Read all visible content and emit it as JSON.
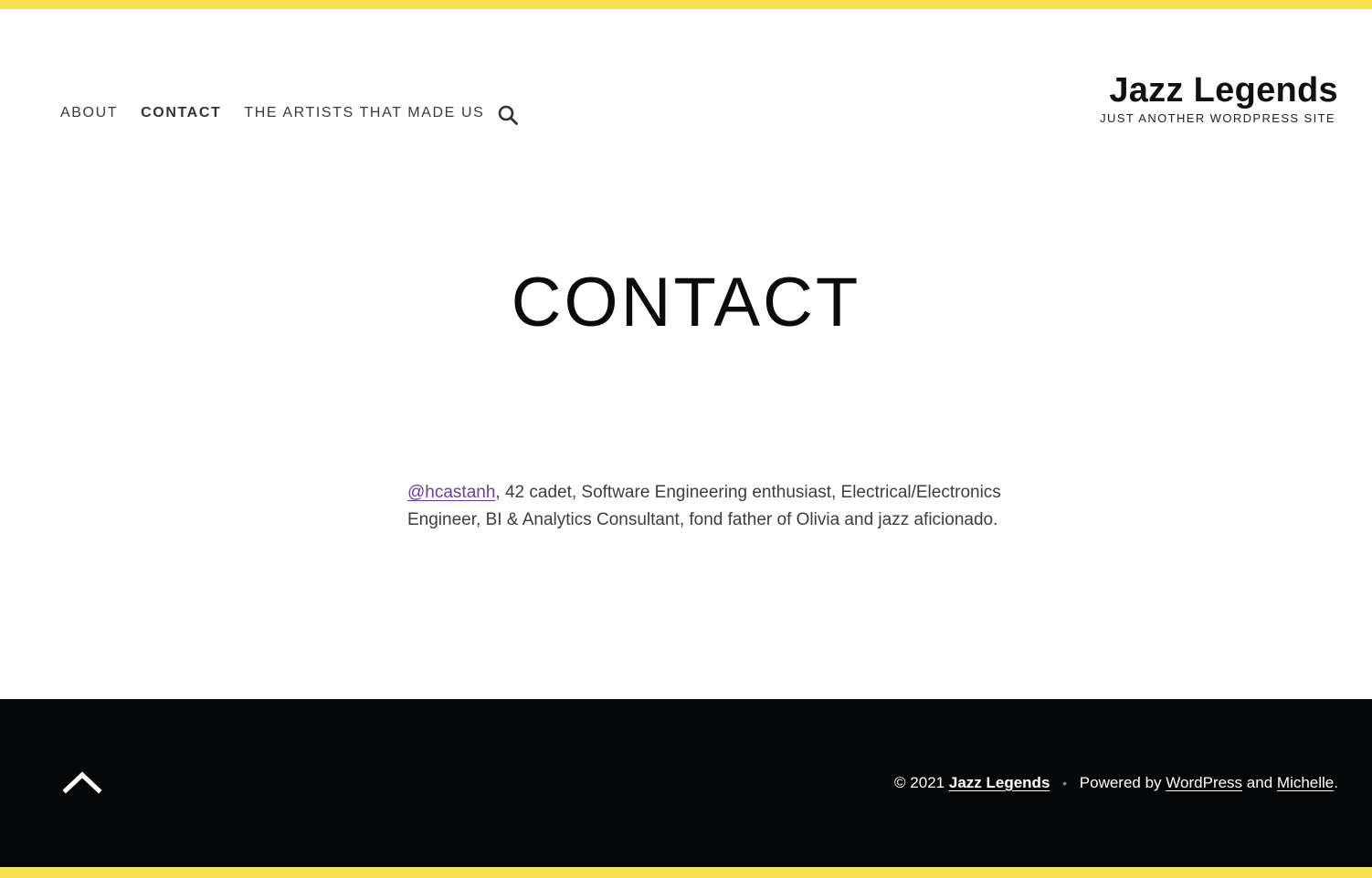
{
  "colors": {
    "accent_bar": "#f9e24f",
    "footer_bg": "#050608",
    "link": "#6a3aa6"
  },
  "header": {
    "nav": [
      {
        "label": "About"
      },
      {
        "label": "Contact"
      },
      {
        "label": "The Artists That Made Us"
      }
    ],
    "current": "Contact",
    "search_icon": "search-icon",
    "site_title": "Jazz Legends",
    "tagline": "Just another WordPress site"
  },
  "main": {
    "title": "CONTACT",
    "handle_link": "@hcastanh",
    "bio_rest": ", 42 cadet, Software Engineering enthusiast, Electrical/Electronics Engineer, BI & Analytics Consultant, fond father of Olivia and jazz aficionado."
  },
  "footer": {
    "back_to_top_icon": "chevron-up-icon",
    "copyright_prefix": "© 2021",
    "site_link": "Jazz Legends",
    "separator": "•",
    "powered_by": "Powered by",
    "wordpress_link": "WordPress",
    "and_text": "and",
    "theme_link": "Michelle",
    "period": "."
  }
}
